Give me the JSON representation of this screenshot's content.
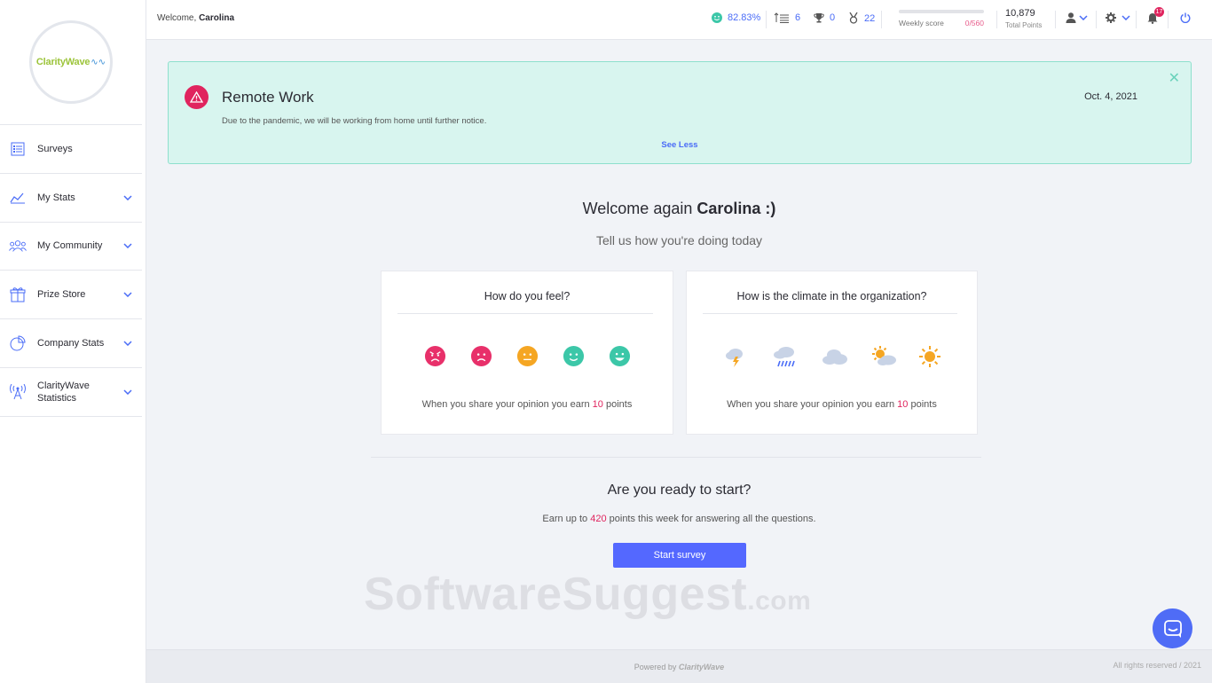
{
  "brand": {
    "name": "ClarityWave",
    "wave_glyph": "∿∿"
  },
  "sidebar": {
    "items": [
      {
        "label": "Surveys",
        "icon": "list-icon",
        "has_chevron": false
      },
      {
        "label": "My Stats",
        "icon": "chart-line-icon",
        "has_chevron": true
      },
      {
        "label": "My Community",
        "icon": "users-icon",
        "has_chevron": true
      },
      {
        "label": "Prize Store",
        "icon": "gift-icon",
        "has_chevron": true
      },
      {
        "label": "Company Stats",
        "icon": "pie-chart-icon",
        "has_chevron": true
      },
      {
        "label": "ClarityWave Statistics",
        "icon": "antenna-icon",
        "has_chevron": true
      }
    ]
  },
  "topbar": {
    "welcome_prefix": "Welcome, ",
    "user_name": "Carolina",
    "score_percent": "82.83%",
    "level": "6",
    "trophies": "0",
    "medals": "22",
    "weekly_label": "Weekly score",
    "weekly_value": "0/560",
    "weekly_progress": 0,
    "total_points": "10,879",
    "total_label": "Total Points",
    "notifications": "17"
  },
  "banner": {
    "title": "Remote Work",
    "date": "Oct. 4, 2021",
    "text": "Due to the pandemic, we will be working from home until further notice.",
    "link": "See Less",
    "close": "✕"
  },
  "main": {
    "greeting_prefix": "Welcome again ",
    "greeting_name": "Carolina :)",
    "subtitle": "Tell us how you're doing today",
    "feel_card": {
      "title": "How do you feel?",
      "note_prefix": "When you share your opinion you earn ",
      "points": "10",
      "note_suffix": " points",
      "options": [
        "angry-face-icon",
        "sad-face-icon",
        "neutral-face-icon",
        "smile-face-icon",
        "happy-face-icon"
      ]
    },
    "climate_card": {
      "title": "How is the climate in the organization?",
      "note_prefix": "When you share your opinion you earn ",
      "points": "10",
      "note_suffix": " points",
      "options": [
        "storm-icon",
        "rain-icon",
        "cloudy-icon",
        "partly-sunny-icon",
        "sunny-icon"
      ]
    },
    "ready_title": "Are you ready to start?",
    "earn_prefix": "Earn up to ",
    "earn_points": "420",
    "earn_suffix": " points this week for answering all the questions.",
    "start_button": "Start survey"
  },
  "watermark": {
    "main": "SoftwareSuggest",
    "suffix": ".com"
  },
  "footer": {
    "powered_prefix": "Powered by ",
    "powered_brand": "ClarityWave",
    "rights": "All rights reserved / 2021"
  },
  "colors": {
    "accent": "#5468ff",
    "pink": "#e0245e",
    "teal": "#3cc7a8",
    "orange": "#f5a623",
    "banner_bg": "#d8f5ef"
  }
}
